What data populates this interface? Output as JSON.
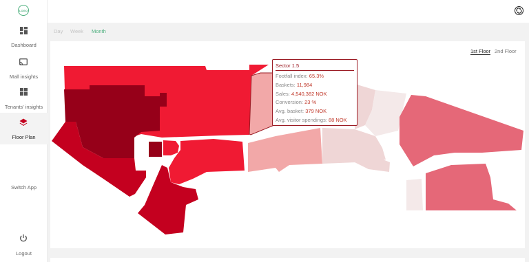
{
  "sidebar": {
    "logo": "LOGO",
    "items": [
      {
        "label": "Dashboard",
        "icon": "dashboard-icon"
      },
      {
        "label": "Mall insights",
        "icon": "cast-icon"
      },
      {
        "label": "Tenants' insights",
        "icon": "grid-icon"
      },
      {
        "label": "Floor Plan",
        "icon": "layers-icon"
      },
      {
        "label": "Switch App",
        "icon": ""
      },
      {
        "label": "Logout",
        "icon": "power-icon"
      }
    ]
  },
  "topbar": {
    "icon": "settings-cycle-icon"
  },
  "period_tabs": [
    "Day",
    "Week",
    "Month"
  ],
  "period_selected": "Month",
  "floor_tabs": [
    "1st Floor",
    "2nd Floor"
  ],
  "floor_selected": "1st Floor",
  "tooltip": {
    "title": "Sector 1.5",
    "rows": [
      {
        "label": "Footfall index: ",
        "value": "65.3%"
      },
      {
        "label": "Baskets: ",
        "value": "11,984"
      },
      {
        "label": "Sales: ",
        "value": "4,540,382 NOK"
      },
      {
        "label": "Conversion: ",
        "value": "23 %"
      },
      {
        "label": "Avg. basket: ",
        "value": "379 NOK"
      },
      {
        "label": "Avg. visitor spendings: ",
        "value": "88 NOK"
      }
    ]
  },
  "colors": {
    "accent": "#4caf7d",
    "darkest": "#960019",
    "dark": "#c4001f",
    "strong": "#f01a33",
    "medium": "#e56878",
    "light": "#f2a8a8",
    "pale": "#efd6d6",
    "palest": "#f4e9e9"
  }
}
